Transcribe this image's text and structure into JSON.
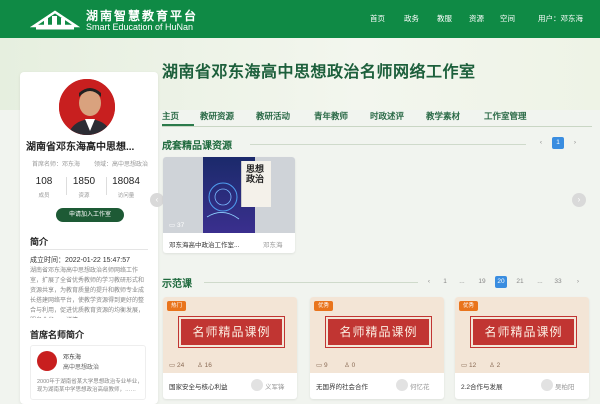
{
  "header": {
    "brand_cn": "湖南智慧教育平台",
    "brand_en": "Smart Education of HuNan",
    "nav": [
      "首页",
      "政务",
      "教服",
      "资源",
      "空间"
    ],
    "user": "用户：邓东海"
  },
  "banner": {
    "title": "湖南省邓东海高中思想政治名师网络工作室"
  },
  "tabs": [
    "主页",
    "教研资源",
    "教研活动",
    "青年教师",
    "时政述评",
    "教学素材",
    "工作室管理"
  ],
  "sidebar": {
    "name": "湖南省邓东海高中思想...",
    "meta_host": "首席名师：邓东海",
    "meta_area": "领域：高中思想政治",
    "stats": [
      {
        "value": "108",
        "label": "成员"
      },
      {
        "value": "1850",
        "label": "资源"
      },
      {
        "value": "18084",
        "label": "访问量"
      }
    ],
    "join_button": "申请加入工作室",
    "intro_title": "简介",
    "created": "成立时间：2022-01-22 15:47:57",
    "intro_text": "湖南省邓东海高中思想政治名师网络工作室，扩展了全省优秀教师的学习教研形式和资源共享，为教育质量的提升和教师专业成长搭建网络平台，使教学资源得到更好的整合与利用，促进优质教育资源的均衡发展，服务全省……详情",
    "mentor_title": "首席名师简介",
    "mentor_name": "邓东海",
    "mentor_role": "高中思想政治",
    "mentor_desc": "2000年于湖南省某大学思想政治专业毕业，现为湖南某中学思想政治高级教师，……"
  },
  "course_section": {
    "title": "成套精品课资源",
    "page": "1",
    "card": {
      "book_title": "思想政治",
      "count": "37",
      "title": "邓东海高中政治工作室...",
      "author": "邓东海"
    }
  },
  "demo_section": {
    "title": "示范课",
    "pages": [
      "1",
      "...",
      "19",
      "20",
      "21",
      "...",
      "33"
    ],
    "active_page": "20",
    "seal_text": "名师精品课例",
    "cards": [
      {
        "tag": "热门",
        "views": "24",
        "likes": "16",
        "title": "国家安全与核心利益",
        "author": "义军锋"
      },
      {
        "tag": "优秀",
        "views": "9",
        "likes": "0",
        "title": "无国界的社会合作",
        "author": "何忆花"
      },
      {
        "tag": "优秀",
        "views": "12",
        "likes": "2",
        "title": "2.2合作与发展",
        "author": "吴柏阳"
      }
    ]
  },
  "colors": {
    "header_green": "#0f8a45",
    "accent_blue": "#3a8de0",
    "seal_red": "#c13532"
  }
}
